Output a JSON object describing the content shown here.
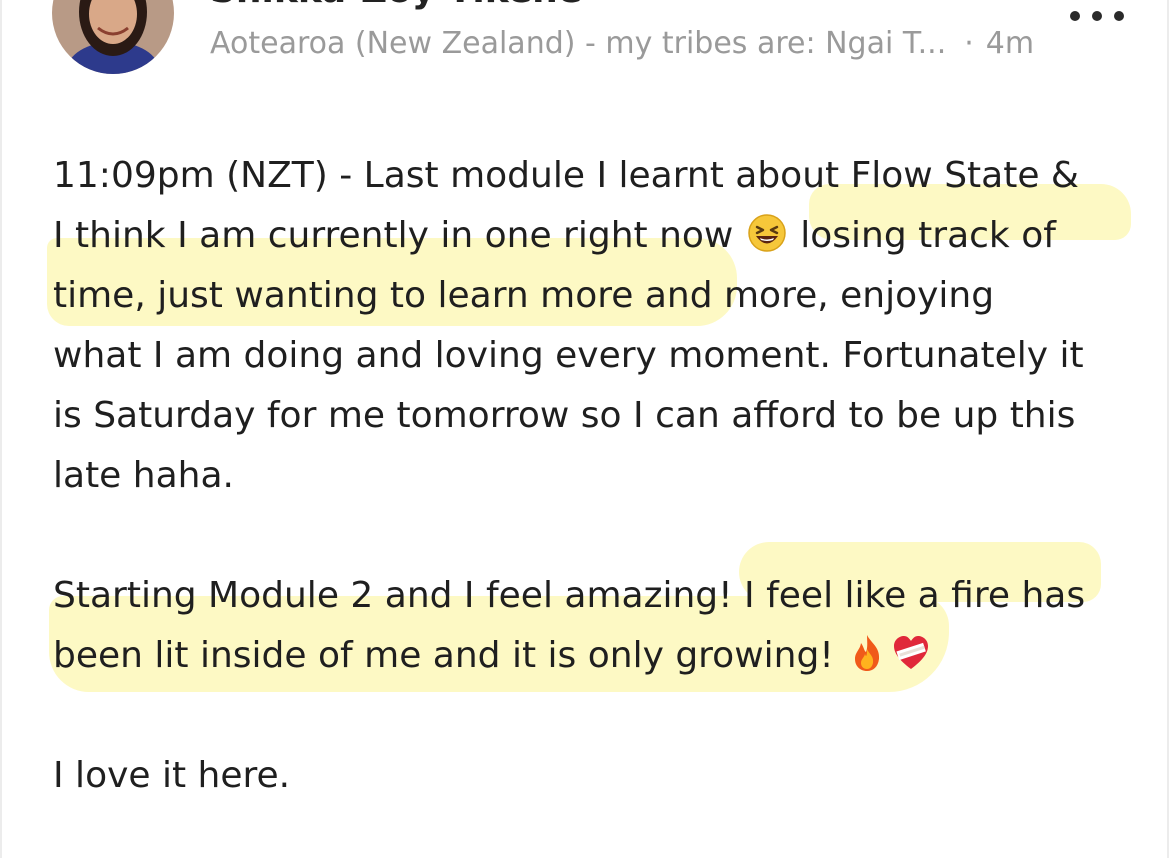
{
  "post": {
    "author_name": "Shikka-Zoy Tikene",
    "location": "Aotearoa (New Zealand) - my tribes are: Ngai T...",
    "separator": "·",
    "time_ago": "4m",
    "body": {
      "para1": {
        "line1": "11:09pm (NZT) - Last module I learnt about Flow State &",
        "line2_before_emoji": "I think I am currently in one right now ",
        "line2_after_emoji": " losing track of",
        "line3": "time, just wanting to learn more and more, enjoying",
        "line4": "what I am doing and loving every moment. Fortunately it",
        "line5": "is Saturday for me tomorrow so I can afford to be up this",
        "line6": "late haha."
      },
      "para2": {
        "line1": "Starting Module 2 and I feel amazing! I feel like a fire has",
        "line2": "been lit inside of me and it is only growing! "
      },
      "para3": {
        "line1": "I love it here."
      }
    },
    "emojis": [
      "laughing-face-icon",
      "fire-icon",
      "mending-heart-icon"
    ],
    "highlight_color": "#fdf9c4"
  }
}
